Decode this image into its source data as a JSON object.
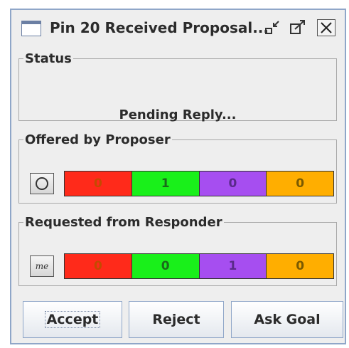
{
  "window": {
    "title": "Pin 20 Received Proposal...",
    "icons": {
      "app": "window-icon",
      "minimize": "minimize-icon",
      "maximize": "maximize-icon",
      "close": "close-icon"
    }
  },
  "status": {
    "legend": "Status",
    "text": "Pending Reply..."
  },
  "offered": {
    "legend": "Offered by Proposer",
    "avatar_icon": "circle-icon",
    "cells": [
      {
        "value": "0",
        "color": "#ff2a1a",
        "text_color": "#c44a00"
      },
      {
        "value": "1",
        "color": "#19f01a",
        "text_color": "#1a6a1a"
      },
      {
        "value": "0",
        "color": "#a64ef0",
        "text_color": "#5a2a8a"
      },
      {
        "value": "0",
        "color": "#ffae00",
        "text_color": "#7a5a00"
      }
    ]
  },
  "requested": {
    "legend": "Requested from Responder",
    "avatar_label": "me",
    "cells": [
      {
        "value": "0",
        "color": "#ff2a1a",
        "text_color": "#c44a00"
      },
      {
        "value": "0",
        "color": "#19f01a",
        "text_color": "#1a6a1a"
      },
      {
        "value": "1",
        "color": "#a64ef0",
        "text_color": "#5a2a8a"
      },
      {
        "value": "0",
        "color": "#ffae00",
        "text_color": "#7a5a00"
      }
    ]
  },
  "actions": {
    "accept": "Accept",
    "reject": "Reject",
    "ask_goal": "Ask Goal"
  }
}
